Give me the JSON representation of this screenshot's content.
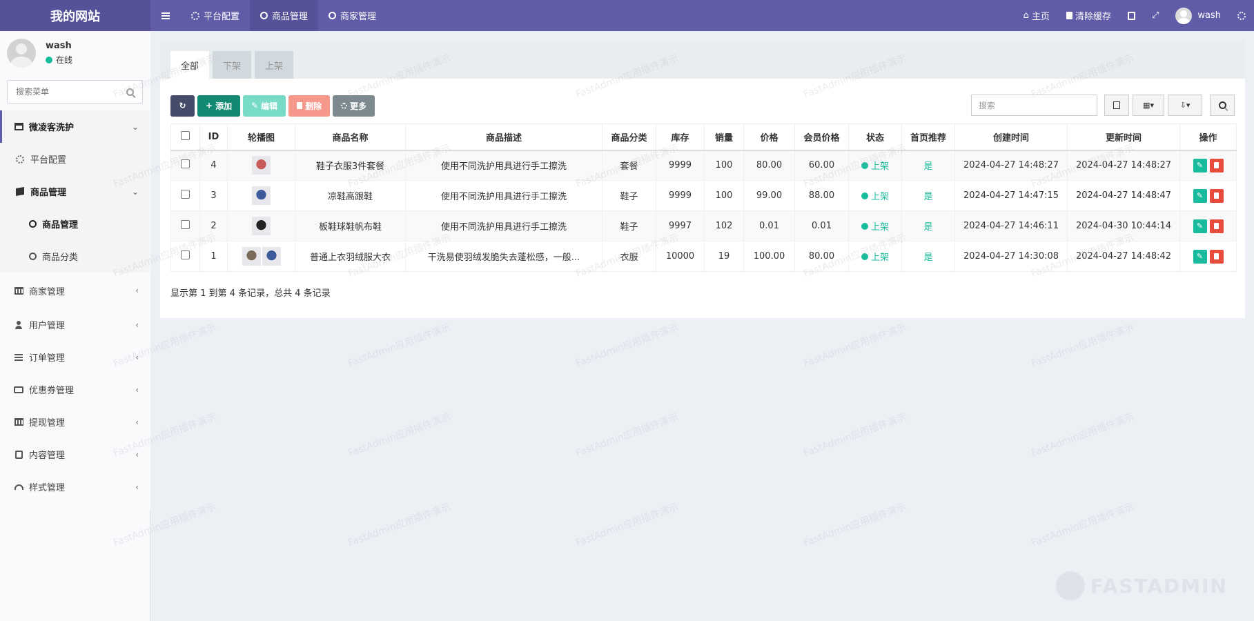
{
  "app": {
    "title": "我的网站"
  },
  "top_nav": {
    "tabs": [
      {
        "label": "平台配置",
        "icon": "gear-icon"
      },
      {
        "label": "商品管理",
        "icon": "circle-icon",
        "active": true
      },
      {
        "label": "商家管理",
        "icon": "circle-icon"
      }
    ],
    "right": {
      "home": "主页",
      "clear_cache": "清除缓存",
      "username": "wash"
    }
  },
  "sidebar": {
    "user": {
      "name": "wash",
      "status": "在线"
    },
    "search_placeholder": "搜索菜单",
    "items": [
      {
        "label": "微凌客洗护",
        "icon": "wash-icon"
      },
      {
        "label": "平台配置",
        "icon": "gear-icon"
      },
      {
        "label": "商品管理",
        "icon": "box-icon"
      },
      {
        "label": "商品管理",
        "icon": "circle-icon"
      },
      {
        "label": "商品分类",
        "icon": "circle-icon"
      },
      {
        "label": "商家管理",
        "icon": "bank-icon"
      },
      {
        "label": "用户管理",
        "icon": "user-icon"
      },
      {
        "label": "订单管理",
        "icon": "list-icon"
      },
      {
        "label": "优惠券管理",
        "icon": "ticket-icon"
      },
      {
        "label": "提现管理",
        "icon": "bank-icon"
      },
      {
        "label": "内容管理",
        "icon": "content-icon"
      },
      {
        "label": "样式管理",
        "icon": "dashboard-icon"
      }
    ]
  },
  "tabs": [
    "全部",
    "下架",
    "上架"
  ],
  "toolbar": {
    "add": "添加",
    "edit": "编辑",
    "delete": "删除",
    "more": "更多",
    "search_placeholder": "搜索"
  },
  "table": {
    "headers": [
      "ID",
      "轮播图",
      "商品名称",
      "商品描述",
      "商品分类",
      "库存",
      "销量",
      "价格",
      "会员价格",
      "状态",
      "首页推荐",
      "创建时间",
      "更新时间",
      "操作"
    ],
    "rows": [
      {
        "id": "4",
        "name": "鞋子衣服3件套餐",
        "desc": "使用不同洗护用具进行手工擦洗",
        "category": "套餐",
        "stock": "9999",
        "sales": "100",
        "price": "80.00",
        "member_price": "60.00",
        "status": "上架",
        "recommend": "是",
        "created": "2024-04-27 14:48:27",
        "updated": "2024-04-27 14:48:27",
        "thumbs": [
          "#c85a5a"
        ]
      },
      {
        "id": "3",
        "name": "凉鞋高跟鞋",
        "desc": "使用不同洗护用具进行手工擦洗",
        "category": "鞋子",
        "stock": "9999",
        "sales": "100",
        "price": "99.00",
        "member_price": "88.00",
        "status": "上架",
        "recommend": "是",
        "created": "2024-04-27 14:47:15",
        "updated": "2024-04-27 14:48:47",
        "thumbs": [
          "#3d5a9a"
        ]
      },
      {
        "id": "2",
        "name": "板鞋球鞋帆布鞋",
        "desc": "使用不同洗护用具进行手工擦洗",
        "category": "鞋子",
        "stock": "9997",
        "sales": "102",
        "price": "0.01",
        "member_price": "0.01",
        "status": "上架",
        "recommend": "是",
        "created": "2024-04-27 14:46:11",
        "updated": "2024-04-30 10:44:14",
        "thumbs": [
          "#222222"
        ]
      },
      {
        "id": "1",
        "name": "普通上衣羽绒服大衣",
        "desc": "干洗易使羽绒发脆失去蓬松感，一般...",
        "category": "衣服",
        "stock": "10000",
        "sales": "19",
        "price": "100.00",
        "member_price": "80.00",
        "status": "上架",
        "recommend": "是",
        "created": "2024-04-27 14:30:08",
        "updated": "2024-04-27 14:48:42",
        "thumbs": [
          "#7a6a5a",
          "#3d5a9a"
        ]
      }
    ]
  },
  "pagination_text": "显示第 1 到第 4 条记录，总共 4 条记录",
  "watermark_text": "FastAdmin应用插件演示",
  "brand_logo_text": "FASTADMIN",
  "colors": {
    "topbar": "#605ca8",
    "accent_green": "#18bc9c",
    "danger": "#e74c3c"
  }
}
